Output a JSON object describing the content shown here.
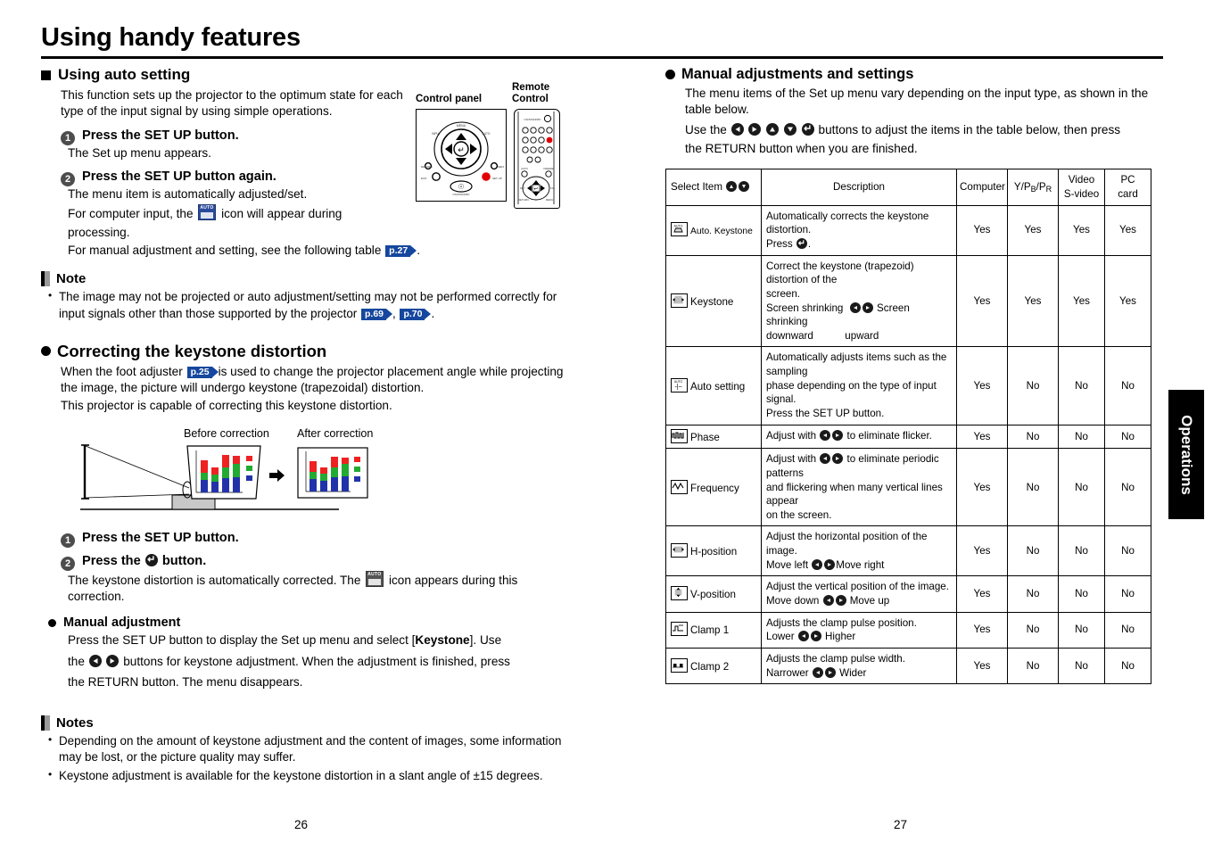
{
  "document": {
    "title": "Using handy features",
    "side_tab": "Operations",
    "page_left": "26",
    "page_right": "27"
  },
  "left": {
    "section1_heading": "Using auto setting",
    "section1_intro": "This function sets up the projector to the optimum state for each type of the input signal by using simple operations.",
    "step1_num": "1",
    "step1_title": "Press the SET UP button.",
    "step1_body": "The Set up menu appears.",
    "step2_num": "2",
    "step2_title": "Press the SET UP button again.",
    "step2_line1": "The menu item is automatically adjusted/set.",
    "step2_line2a": "For computer input, the",
    "step2_line2b": "icon will appear during",
    "step2_line3": "processing.",
    "step2_line4a": "For manual adjustment and setting, see the following table",
    "step2_ref": "p.27",
    "step2_line4b": ".",
    "note_heading": "Note",
    "note_items_a": "The image may not be projected or auto adjustment/setting may not be performed correctly for input signals other than those supported by the projector",
    "note_ref1": "p.69",
    "note_sep": ",",
    "note_ref2": "p.70",
    "note_end": ".",
    "section2_heading": "Correcting the keystone distortion",
    "section2_p1a": "When the foot adjuster",
    "section2_ref": "p.25",
    "section2_p1b": "is used to change the projector placement angle while projecting the image, the picture will undergo keystone (trapezoidal) distortion.",
    "section2_p2": "This projector is capable of correcting this keystone distortion.",
    "diagram_before": "Before correction",
    "diagram_after": "After correction",
    "step3_num": "1",
    "step3_title": "Press the SET UP button.",
    "step4_num": "2",
    "step4_title_a": "Press the",
    "step4_title_b": "button.",
    "step4_body_a": "The keystone distortion is automatically corrected. The",
    "step4_body_b": "icon appears during this correction.",
    "manual_adj_heading": "Manual adjustment",
    "manual_adj_p1a": "Press the SET UP button to display the Set up menu and select [",
    "manual_adj_bold": "Keystone",
    "manual_adj_p1b": "]. Use",
    "manual_adj_p2a": "the",
    "manual_adj_p2b": "buttons for keystone adjustment. When the adjustment is finished, press",
    "manual_adj_p3": "the RETURN button. The menu disappears.",
    "notes_heading": "Notes",
    "notes_item1": "Depending on the amount of keystone adjustment and the content of images, some information may be lost, or the picture quality may suffer.",
    "notes_item2": "Keystone adjustment is available for the keystone distortion in a slant angle of ±15 degrees."
  },
  "devices": {
    "control_panel_label_line1": "Control panel",
    "remote_label_line1": "Remote",
    "remote_label_line2": "Control"
  },
  "right": {
    "heading": "Manual adjustments and settings",
    "p1": "The menu items of the Set up menu vary depending on the input type, as shown in the table below.",
    "p2a": "Use the",
    "p2b": "buttons to adjust the items in the table below, then press",
    "p3": "the RETURN button when you are finished."
  },
  "table": {
    "headers": {
      "select_item": "Select Item",
      "description": "Description",
      "computer": "Computer",
      "ypbpr_pre": "Y/P",
      "ypbpr_sub1": "B",
      "ypbpr_mid": "/P",
      "ypbpr_sub2": "R",
      "video_line1": "Video",
      "video_line2": "S-video",
      "pc_line1": "PC",
      "pc_line2": "card"
    },
    "rows": [
      {
        "icon": "auto-keystone-icon",
        "item": "Auto. Keystone",
        "item_small": true,
        "desc_lines": [
          "Automatically corrects the keystone distortion.",
          "Press ."
        ],
        "computer": "Yes",
        "ypbpr": "Yes",
        "video": "Yes",
        "pc": "Yes"
      },
      {
        "icon": "keystone-icon",
        "item": "Keystone",
        "item_small": false,
        "desc_lines": [
          "Correct the keystone (trapezoid) distortion of the",
          "screen.",
          "Screen shrinking      Screen shrinking",
          "downward                     upward"
        ],
        "computer": "Yes",
        "ypbpr": "Yes",
        "video": "Yes",
        "pc": "Yes"
      },
      {
        "icon": "auto-setting-icon",
        "item": "Auto setting",
        "item_small": false,
        "desc_lines": [
          "Automatically adjusts items such as the sampling",
          "phase depending on the type of input signal.",
          "Press the SET UP button."
        ],
        "computer": "Yes",
        "ypbpr": "No",
        "video": "No",
        "pc": "No"
      },
      {
        "icon": "phase-icon",
        "item": "Phase",
        "item_small": false,
        "desc_lines": [
          "Adjust with      to eliminate flicker."
        ],
        "computer": "Yes",
        "ypbpr": "No",
        "video": "No",
        "pc": "No"
      },
      {
        "icon": "frequency-icon",
        "item": "Frequency",
        "item_small": false,
        "desc_lines": [
          "Adjust with       to eliminate periodic patterns",
          "and flickering when many vertical lines appear",
          "on the screen."
        ],
        "computer": "Yes",
        "ypbpr": "No",
        "video": "No",
        "pc": "No"
      },
      {
        "icon": "h-position-icon",
        "item": "H-position",
        "item_small": false,
        "desc_lines": [
          "Adjust the horizontal position of the image.",
          "Move left      Move right"
        ],
        "computer": "Yes",
        "ypbpr": "No",
        "video": "No",
        "pc": "No"
      },
      {
        "icon": "v-position-icon",
        "item": "V-position",
        "item_small": false,
        "desc_lines": [
          "Adjust the vertical position of the image.",
          "Move down      Move up"
        ],
        "computer": "Yes",
        "ypbpr": "No",
        "video": "No",
        "pc": "No"
      },
      {
        "icon": "clamp1-icon",
        "item": "Clamp 1",
        "item_small": false,
        "desc_lines": [
          "Adjusts the clamp pulse position.",
          "Lower      Higher"
        ],
        "computer": "Yes",
        "ypbpr": "No",
        "video": "No",
        "pc": "No"
      },
      {
        "icon": "clamp2-icon",
        "item": "Clamp 2",
        "item_small": false,
        "desc_lines": [
          "Adjusts the clamp pulse width.",
          "Narrower      Wider"
        ],
        "computer": "Yes",
        "ypbpr": "No",
        "video": "No",
        "pc": "No"
      }
    ],
    "cells": {
      "r0": {
        "desc1": "Automatically corrects the keystone distortion.",
        "desc2": "Press"
      },
      "r1": {
        "desc1": "Correct the keystone (trapezoid) distortion of the",
        "desc2": "screen.",
        "desc3a": "Screen shrinking",
        "desc3b": "Screen shrinking",
        "desc4a": "downward",
        "desc4b": "upward"
      },
      "r2": {
        "desc1": "Automatically adjusts items such as the sampling",
        "desc2": "phase depending on the type of input signal.",
        "desc3": "Press the SET UP button."
      },
      "r3": {
        "desc1a": "Adjust with",
        "desc1b": "to eliminate flicker."
      },
      "r4": {
        "desc1a": "Adjust with",
        "desc1b": "to eliminate periodic patterns",
        "desc2": "and flickering when many vertical lines appear",
        "desc3": "on the screen."
      },
      "r5": {
        "desc1": "Adjust the horizontal position of the image.",
        "desc2a": "Move left",
        "desc2b": "Move right"
      },
      "r6": {
        "desc1": "Adjust the vertical position of the image.",
        "desc2a": "Move down",
        "desc2b": "Move up"
      },
      "r7": {
        "desc1": "Adjusts the clamp pulse position.",
        "desc2a": "Lower",
        "desc2b": "Higher"
      },
      "r8": {
        "desc1": "Adjusts the clamp pulse width.",
        "desc2a": "Narrower",
        "desc2b": "Wider"
      }
    }
  },
  "colors": {
    "page_ref_blue": "#15479e",
    "osd_icon_blue": "#2b4a9b",
    "side_tab": "#000000",
    "chart_red": "#ee2222",
    "chart_green": "#22aa33",
    "chart_blue": "#2233aa"
  }
}
